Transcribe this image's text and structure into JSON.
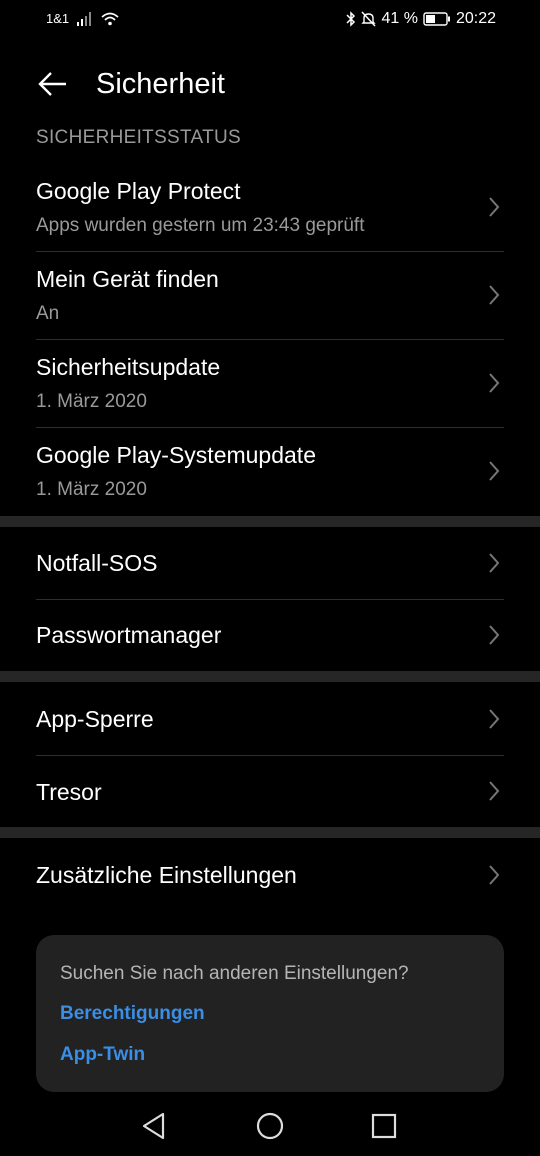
{
  "status_bar": {
    "carrier": "1&1",
    "battery_percent": "41 %",
    "time": "20:22"
  },
  "header": {
    "title": "Sicherheit"
  },
  "security_status": {
    "heading": "SICHERHEITSSTATUS",
    "items": [
      {
        "title": "Google Play Protect",
        "subtitle": "Apps wurden gestern um 23:43 geprüft"
      },
      {
        "title": "Mein Gerät finden",
        "subtitle": "An"
      },
      {
        "title": "Sicherheitsupdate",
        "subtitle": "1. März 2020"
      },
      {
        "title": "Google Play-Systemupdate",
        "subtitle": "1. März 2020"
      }
    ]
  },
  "group2": {
    "items": [
      {
        "title": "Notfall-SOS"
      },
      {
        "title": "Passwortmanager"
      }
    ]
  },
  "group3": {
    "items": [
      {
        "title": "App-Sperre"
      },
      {
        "title": "Tresor"
      }
    ]
  },
  "group4": {
    "items": [
      {
        "title": "Zusätzliche Einstellungen"
      }
    ]
  },
  "search_card": {
    "title": "Suchen Sie nach anderen Einstellungen?",
    "links": [
      "Berechtigungen",
      "App-Twin"
    ]
  },
  "colors": {
    "background": "#000000",
    "secondary_text": "#9a9a9a",
    "link": "#3a8ee6"
  }
}
